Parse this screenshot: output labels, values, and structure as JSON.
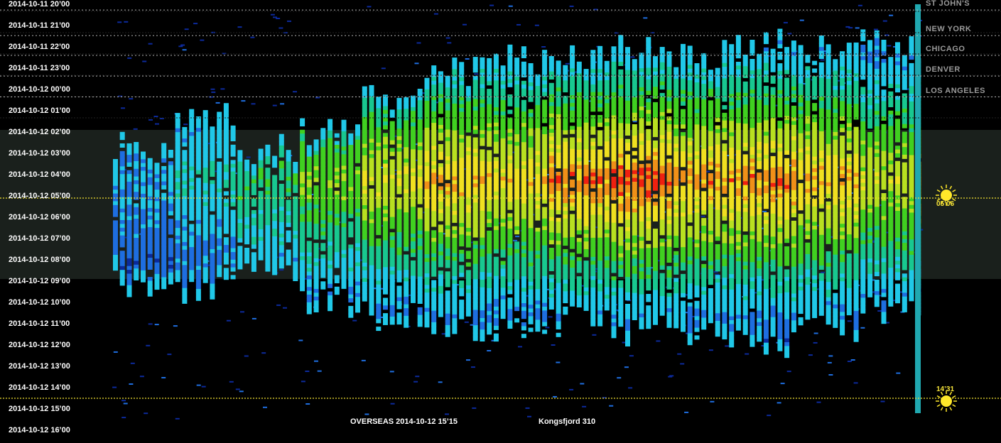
{
  "chart_data": {
    "type": "heatmap",
    "time_labels": [
      "2014-10-11 20’00",
      "2014-10-11 21’00",
      "2014-10-11 22’00",
      "2014-10-11 23’00",
      "2014-10-12 00’00",
      "2014-10-12 01’00",
      "2014-10-12 02’00",
      "2014-10-12 03’00",
      "2014-10-12 04’00",
      "2014-10-12 05’00",
      "2014-10-12 06’00",
      "2014-10-12 07’00",
      "2014-10-12 08’00",
      "2014-10-12 09’00",
      "2014-10-12 10’00",
      "2014-10-12 11’00",
      "2014-10-12 12’00",
      "2014-10-12 13’00",
      "2014-10-12 14’00",
      "2014-10-12 15’00",
      "2014-10-12 16’00"
    ],
    "city_markers": [
      {
        "name": "ST JOHN'S",
        "hour": 0.27
      },
      {
        "name": "NEW YORK",
        "hour": 1.47
      },
      {
        "name": "CHICAGO",
        "hour": 2.4
      },
      {
        "name": "DENVER",
        "hour": 3.37
      },
      {
        "name": "LOS ANGELES",
        "hour": 4.35
      }
    ],
    "sun_events": [
      {
        "label": "05’06",
        "hour": 9.1,
        "type": "sunrise"
      },
      {
        "label": "14’31",
        "hour": 18.5,
        "type": "sunset"
      }
    ],
    "night_band": {
      "start_hour": 5.9,
      "end_hour": 12.9
    },
    "bands": [
      {
        "start_hour": 6.7,
        "end_hour": 12.9,
        "intensity": 0.28
      },
      {
        "start_hour": 5.2,
        "end_hour": 13.4,
        "intensity": 0.38
      },
      {
        "start_hour": 6.8,
        "end_hour": 12.6,
        "intensity": 0.5
      },
      {
        "start_hour": 6.0,
        "end_hour": 13.8,
        "intensity": 0.63
      },
      {
        "start_hour": 4.3,
        "end_hour": 14.6,
        "intensity": 0.75
      },
      {
        "start_hour": 3.1,
        "end_hour": 15.1,
        "intensity": 0.85
      },
      {
        "start_hour": 2.6,
        "end_hour": 15.4,
        "intensity": 0.82
      },
      {
        "start_hour": 2.3,
        "end_hour": 14.8,
        "intensity": 0.9
      },
      {
        "start_hour": 2.0,
        "end_hour": 15.2,
        "intensity": 0.95
      },
      {
        "start_hour": 2.4,
        "end_hour": 15.6,
        "intensity": 0.88
      },
      {
        "start_hour": 1.7,
        "end_hour": 15.9,
        "intensity": 0.9
      },
      {
        "start_hour": 2.1,
        "end_hour": 15.3,
        "intensity": 0.85
      },
      {
        "start_hour": 1.8,
        "end_hour": 14.4,
        "intensity": 0.72
      }
    ],
    "caption_left": "OVERSEAS 2014-10-12 15’15",
    "caption_right": "Kongsfjord 310"
  },
  "colors": {
    "background": "#000000",
    "night_band": "#1a201c",
    "dotted_line": "#b5b5b5",
    "sun_line": "#f0e030",
    "label": "#ffffff",
    "city": "#9a9a9a"
  }
}
